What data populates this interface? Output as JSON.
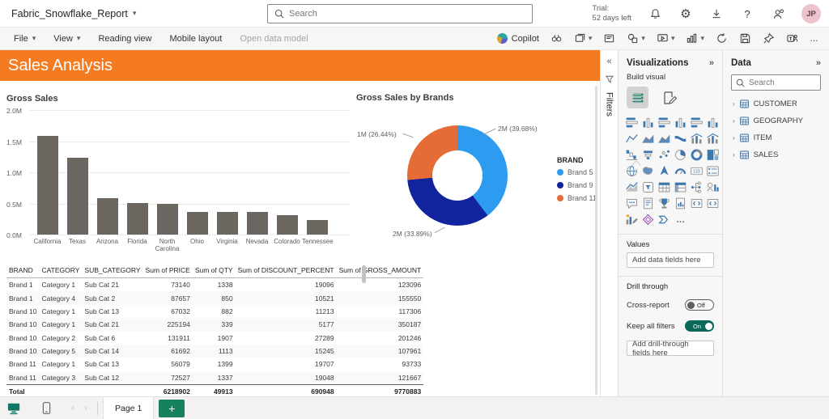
{
  "header": {
    "report_name": "Fabric_Snowflake_Report",
    "search_placeholder": "Search",
    "trial_line1": "Trial:",
    "trial_line2": "52 days left",
    "avatar_initials": "JP",
    "icons": [
      "notifications-icon",
      "settings-icon",
      "download-icon",
      "help-icon",
      "feedback-icon"
    ]
  },
  "menubar": {
    "items": [
      {
        "label": "File",
        "chevron": true
      },
      {
        "label": "View",
        "chevron": true
      },
      {
        "label": "Reading view"
      },
      {
        "label": "Mobile layout"
      },
      {
        "label": "Open data model",
        "disabled": true
      }
    ],
    "copilot_label": "Copilot",
    "right_icons": [
      "explore-icon",
      "bookmarks-icon",
      "text-box-icon",
      "shapes-icon",
      "present-icon",
      "new-visual-icon",
      "refresh-icon",
      "save-icon",
      "pin-icon",
      "teams-icon",
      "more-options-icon"
    ]
  },
  "banner": {
    "title": "Sales Analysis",
    "color": "#F47B20"
  },
  "filters_pane": {
    "label": "Filters"
  },
  "viz_pane": {
    "title": "Visualizations",
    "subtitle": "Build visual",
    "values_label": "Values",
    "values_placeholder": "Add data fields here",
    "drill_label": "Drill through",
    "cross_report_label": "Cross-report",
    "cross_report_state": "Off",
    "keep_filters_label": "Keep all filters",
    "keep_filters_state": "On",
    "drill_placeholder": "Add drill-through fields here",
    "gallery": [
      {
        "name": "stacked-bar-chart-icon",
        "type": "hbars"
      },
      {
        "name": "stacked-column-chart-icon",
        "type": "vbars"
      },
      {
        "name": "clustered-bar-chart-icon",
        "type": "hbars"
      },
      {
        "name": "clustered-column-chart-icon",
        "type": "vbars"
      },
      {
        "name": "100-stacked-bar-chart-icon",
        "type": "hbars"
      },
      {
        "name": "100-stacked-column-chart-icon",
        "type": "vbars"
      },
      {
        "name": "line-chart-icon",
        "type": "line"
      },
      {
        "name": "area-chart-icon",
        "type": "area"
      },
      {
        "name": "stacked-area-chart-icon",
        "type": "area"
      },
      {
        "name": "ribbon-chart-icon",
        "type": "ribbon"
      },
      {
        "name": "line-stacked-column-chart-icon",
        "type": "combo"
      },
      {
        "name": "line-clustered-column-chart-icon",
        "type": "combo"
      },
      {
        "name": "waterfall-chart-icon",
        "type": "waterfall"
      },
      {
        "name": "funnel-chart-icon",
        "type": "funnel"
      },
      {
        "name": "scatter-chart-icon",
        "type": "scatter"
      },
      {
        "name": "pie-chart-icon",
        "type": "pie"
      },
      {
        "name": "donut-chart-icon",
        "type": "donutI"
      },
      {
        "name": "treemap-icon",
        "type": "treemap"
      },
      {
        "name": "map-icon",
        "type": "globe"
      },
      {
        "name": "filled-map-icon",
        "type": "filledmap"
      },
      {
        "name": "azure-map-icon",
        "type": "azuremap"
      },
      {
        "name": "gauge-icon",
        "type": "gauge"
      },
      {
        "name": "card-icon",
        "type": "card"
      },
      {
        "name": "multi-row-card-icon",
        "type": "multirow"
      },
      {
        "name": "kpi-icon",
        "type": "kpi"
      },
      {
        "name": "slicer-icon",
        "type": "slicer"
      },
      {
        "name": "table-icon",
        "type": "tableI"
      },
      {
        "name": "matrix-icon",
        "type": "matrix"
      },
      {
        "name": "decomposition-tree-icon",
        "type": "tree"
      },
      {
        "name": "key-influencers-icon",
        "type": "influencer"
      },
      {
        "name": "qna-visual-icon",
        "type": "speech"
      },
      {
        "name": "smart-narrative-icon",
        "type": "narrative"
      },
      {
        "name": "metrics-icon",
        "type": "trophy"
      },
      {
        "name": "paginated-report-icon",
        "type": "paginated"
      },
      {
        "name": "script-visual-icon",
        "type": "code"
      },
      {
        "name": "r-script-visual-icon",
        "type": "code"
      },
      {
        "name": "python-visual-icon",
        "type": "pencilchart"
      },
      {
        "name": "power-apps-icon",
        "type": "diamond"
      },
      {
        "name": "power-automate-icon",
        "type": "flow"
      },
      {
        "name": "more-visuals-icon",
        "type": "dots"
      }
    ]
  },
  "data_pane": {
    "title": "Data",
    "search_placeholder": "Search",
    "tables": [
      "CUSTOMER",
      "GEOGRAPHY",
      "ITEM",
      "SALES"
    ]
  },
  "footer": {
    "page_label": "Page 1"
  },
  "chart_data": [
    {
      "type": "bar",
      "title": "Gross Sales",
      "categories": [
        "California",
        "Texas",
        "Arizona",
        "Florida",
        "North Carolina",
        "Ohio",
        "Virginia",
        "Nevada",
        "Colorado",
        "Tennessee"
      ],
      "values": [
        1.58,
        1.24,
        0.59,
        0.51,
        0.5,
        0.37,
        0.36,
        0.36,
        0.31,
        0.23
      ],
      "value_unit": "M",
      "ylim": [
        0,
        2.0
      ],
      "yticks": [
        "0.0M",
        "0.5M",
        "1.0M",
        "1.5M",
        "2.0M"
      ],
      "bar_color": "#6b6660",
      "grid": true
    },
    {
      "type": "pie",
      "subtype": "donut",
      "title": "Gross Sales by Brands",
      "legend_title": "BRAND",
      "legend_position": "right",
      "slices": [
        {
          "name": "Brand 5",
          "label": "2M (39.68%)",
          "pct": 39.68,
          "color": "#2D9BF0"
        },
        {
          "name": "Brand 9",
          "label": "2M (33.89%)",
          "pct": 33.89,
          "color": "#12239E"
        },
        {
          "name": "Brand 11",
          "label": "1M (26.44%)",
          "pct": 26.44,
          "color": "#E66C37"
        }
      ]
    },
    {
      "type": "table",
      "headers": [
        "BRAND",
        "CATEGORY",
        "SUB_CATEGORY",
        "Sum of PRICE",
        "Sum of QTY",
        "Sum of DISCOUNT_PERCENT",
        "Sum of GROSS_AMOUNT"
      ],
      "rows": [
        [
          "Brand 1",
          "Category 1",
          "Sub Cat 21",
          "73140",
          "1338",
          "19096",
          "123096"
        ],
        [
          "Brand 1",
          "Category 4",
          "Sub Cat 2",
          "87657",
          "850",
          "10521",
          "155550"
        ],
        [
          "Brand 10",
          "Category 1",
          "Sub Cat 13",
          "67032",
          "882",
          "11213",
          "117306"
        ],
        [
          "Brand 10",
          "Category 1",
          "Sub Cat 21",
          "225194",
          "339",
          "5177",
          "350187"
        ],
        [
          "Brand 10",
          "Category 2",
          "Sub Cat 6",
          "131911",
          "1907",
          "27289",
          "201246"
        ],
        [
          "Brand 10",
          "Category 5",
          "Sub Cat 14",
          "61692",
          "1113",
          "15245",
          "107961"
        ],
        [
          "Brand 11",
          "Category 1",
          "Sub Cat 13",
          "56079",
          "1399",
          "19707",
          "93733"
        ],
        [
          "Brand 11",
          "Category 3",
          "Sub Cat 12",
          "72527",
          "1337",
          "19048",
          "121667"
        ]
      ],
      "total_row": [
        "Total",
        "",
        "",
        "6218902",
        "49913",
        "690948",
        "9770883"
      ]
    }
  ],
  "colors": {
    "banner": "#F47B20",
    "accent_teal": "#117865",
    "add_page_green": "#17805f",
    "toggle_on": "#0c695a"
  }
}
